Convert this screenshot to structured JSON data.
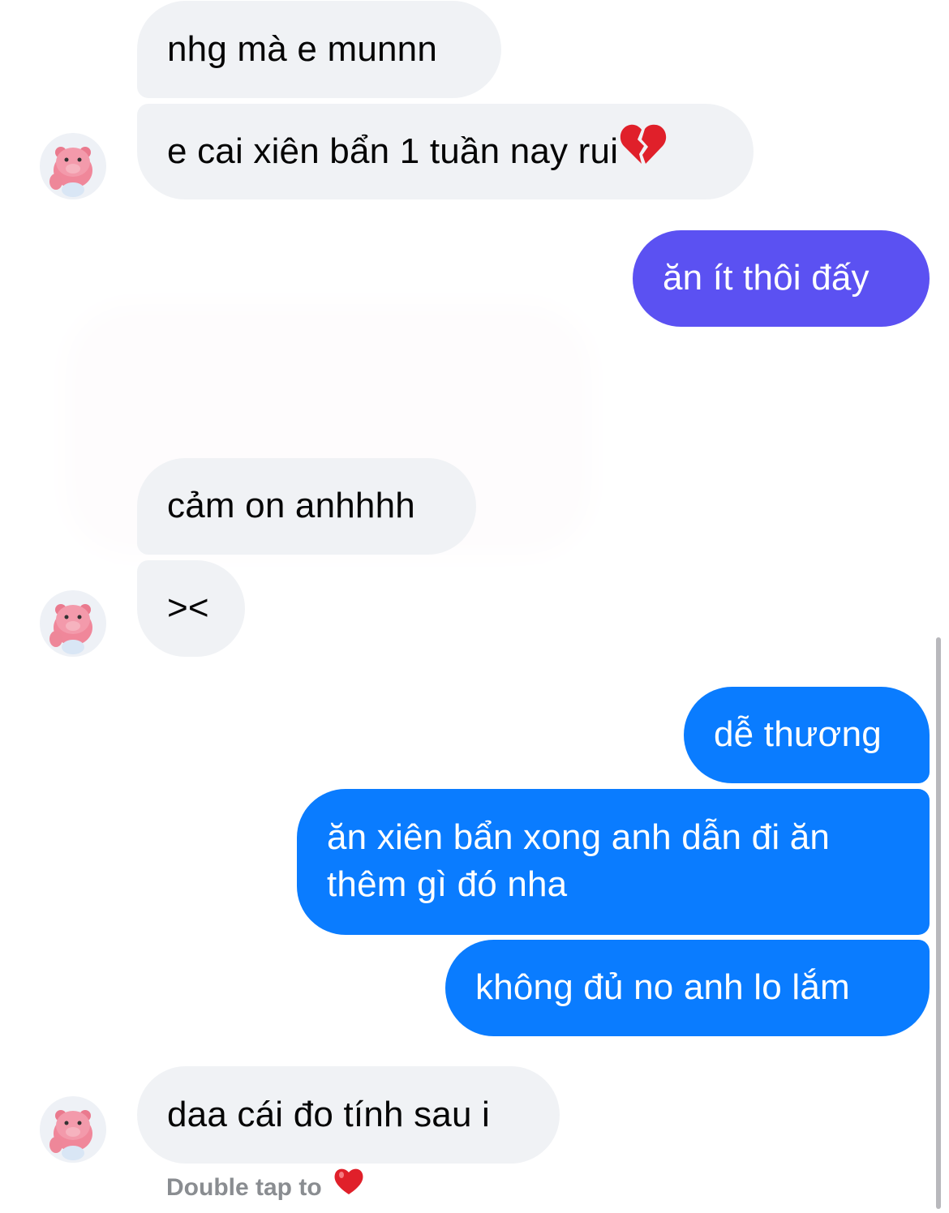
{
  "messages": {
    "m1": "nhg mà e munnn",
    "m2": "e cai xiên bẩn 1 tuần nay rui",
    "m2_emoji": "broken-heart",
    "m3": "ăn ít thôi đấy",
    "m4": "cảm on anhhhh",
    "m5": "><",
    "m6": "dễ thương",
    "m7_line1": "ăn xiên bẩn xong anh dẫn đi ăn",
    "m7_line2": "thêm gì đó nha",
    "m8": "không đủ no anh lo lắm",
    "m9": "daa cái đo tính sau i"
  },
  "reaction_hint": {
    "label": "Double tap to",
    "icon": "red-heart-icon"
  },
  "colors": {
    "incoming_bubble": "#f0f2f5",
    "outgoing_purple": "#5b51f2",
    "outgoing_blue": "#0a7cff",
    "hint_text": "#8a8d91",
    "heart": "#e0202a"
  }
}
